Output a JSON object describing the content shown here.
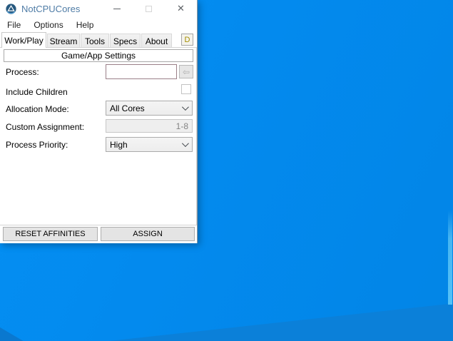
{
  "desktop": {
    "base_color": "#0389ee",
    "lower_beam_color": "#0b80d9",
    "stripe_color": "#45b5f2"
  },
  "window": {
    "title": "NotCPUCores",
    "titlebar": {
      "close_glyph": "✕"
    },
    "menu": {
      "items": [
        "File",
        "Options",
        "Help"
      ]
    },
    "tabs": {
      "items": [
        "Work/Play",
        "Stream",
        "Tools",
        "Specs",
        "About"
      ],
      "active": "Work/Play"
    },
    "donate_button_label": "D",
    "group_title": "Game/App Settings",
    "form": {
      "process": {
        "label": "Process:",
        "value": "",
        "browse_glyph": "⇦"
      },
      "include_children": {
        "label": "Include Children",
        "checked": false
      },
      "allocation_mode": {
        "label": "Allocation Mode:",
        "value": "All Cores"
      },
      "custom_assignment": {
        "label": "Custom Assignment:",
        "value": "1-8"
      },
      "process_priority": {
        "label": "Process Priority:",
        "value": "High"
      }
    },
    "buttons": {
      "reset": "RESET AFFINITIES",
      "assign": "ASSIGN"
    }
  }
}
